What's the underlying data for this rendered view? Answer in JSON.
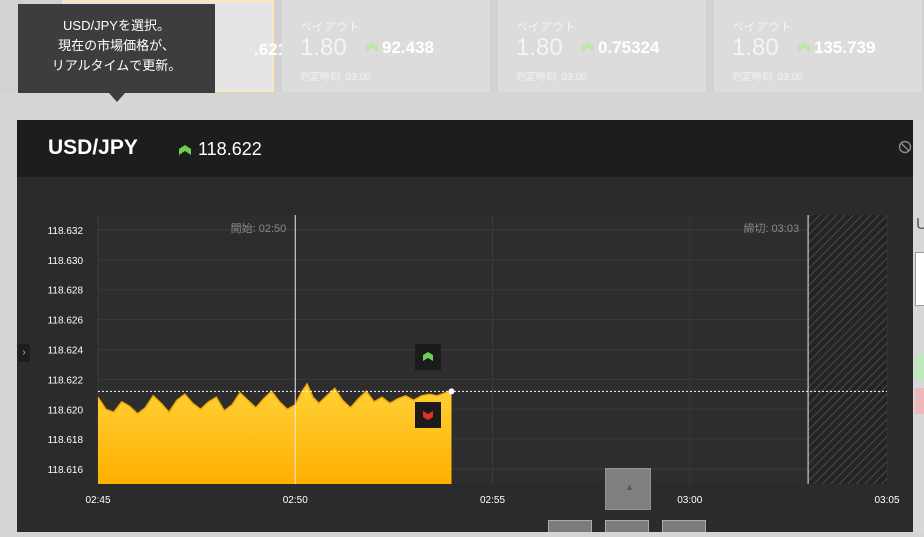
{
  "tooltip": {
    "line1": "USD/JPYを選択。",
    "line2": "現在の市場価格が、",
    "line3": "リアルタイムで更新。"
  },
  "cards": [
    {
      "payout_label": "",
      "payout_value": "",
      "price": ".621",
      "judge": ""
    },
    {
      "payout_label": "ペイアウト",
      "payout_value": "1.80",
      "price": "92.438",
      "judge": "判定時刻: 03:00"
    },
    {
      "payout_label": "ペイアウト",
      "payout_value": "1.80",
      "price": "0.75324",
      "judge": "判定時刻: 03:00"
    },
    {
      "payout_label": "ペイアウト",
      "payout_value": "1.80",
      "price": "135.739",
      "judge": "判定時刻: 03:00"
    }
  ],
  "panel": {
    "pair": "USD/JPY",
    "price": "118.622",
    "right_letter": "U"
  },
  "side_toggle": "›",
  "scroll_box_icon": "▲",
  "colors": {
    "up": "#6ccf4f",
    "down": "#e0322b",
    "area_top": "#ffd23a",
    "area_bottom": "#ffb000",
    "line": "#f6a800"
  },
  "icons": {
    "price_up": "up-chevron-icon",
    "trade_up": "up-chevron-icon",
    "trade_down": "down-chevron-icon",
    "header_right": "no-entry-icon"
  },
  "chart_data": {
    "type": "area",
    "start_label": "開始: 02:50",
    "end_label": "締切: 03:03",
    "x_ticks": [
      "02:45",
      "02:50",
      "02:55",
      "03:00",
      "03:05"
    ],
    "y_ticks": [
      "118.632",
      "118.630",
      "118.628",
      "118.626",
      "118.624",
      "118.622",
      "118.620",
      "118.618",
      "118.616"
    ],
    "ylim": [
      118.615,
      118.633
    ],
    "x_range_min": [
      0,
      20
    ],
    "start_time_min": 5,
    "end_time_min": 18,
    "current_value": 118.6212,
    "series": [
      {
        "values": [
          [
            0.0,
            118.6208
          ],
          [
            0.2,
            118.62
          ],
          [
            0.4,
            118.6198
          ],
          [
            0.6,
            118.6205
          ],
          [
            0.8,
            118.6202
          ],
          [
            1.0,
            118.6197
          ],
          [
            1.2,
            118.6201
          ],
          [
            1.4,
            118.6209
          ],
          [
            1.6,
            118.6204
          ],
          [
            1.8,
            118.6198
          ],
          [
            2.0,
            118.6206
          ],
          [
            2.2,
            118.621
          ],
          [
            2.4,
            118.6204
          ],
          [
            2.6,
            118.62
          ],
          [
            2.8,
            118.6205
          ],
          [
            3.0,
            118.6208
          ],
          [
            3.2,
            118.6199
          ],
          [
            3.4,
            118.6203
          ],
          [
            3.6,
            118.6211
          ],
          [
            3.8,
            118.6206
          ],
          [
            4.0,
            118.6201
          ],
          [
            4.2,
            118.6207
          ],
          [
            4.4,
            118.6212
          ],
          [
            4.6,
            118.6205
          ],
          [
            4.8,
            118.62
          ],
          [
            5.0,
            118.6203
          ],
          [
            5.15,
            118.6211
          ],
          [
            5.3,
            118.6217
          ],
          [
            5.45,
            118.6208
          ],
          [
            5.6,
            118.6204
          ],
          [
            5.8,
            118.6209
          ],
          [
            6.0,
            118.6214
          ],
          [
            6.2,
            118.6206
          ],
          [
            6.4,
            118.6201
          ],
          [
            6.6,
            118.6207
          ],
          [
            6.8,
            118.6212
          ],
          [
            7.0,
            118.6205
          ],
          [
            7.2,
            118.6208
          ],
          [
            7.4,
            118.6204
          ],
          [
            7.6,
            118.6207
          ],
          [
            7.8,
            118.6209
          ],
          [
            8.0,
            118.6206
          ],
          [
            8.2,
            118.6209
          ],
          [
            8.4,
            118.621
          ],
          [
            8.6,
            118.6209
          ],
          [
            8.8,
            118.6211
          ],
          [
            8.96,
            118.6212
          ]
        ]
      }
    ]
  }
}
